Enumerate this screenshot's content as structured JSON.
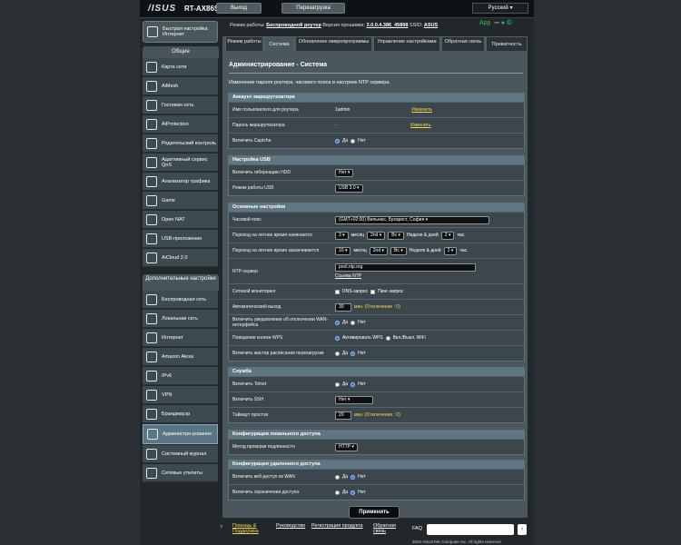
{
  "header": {
    "brand": "/ISUS",
    "model": "RT-AX86S",
    "logout": "Выход",
    "reboot": "Перезагрузка",
    "language": "Русский"
  },
  "info": {
    "mode_label": "Режим работы:",
    "mode_value": "Беспроводной роутер",
    "fw_label": "Версия прошивки:",
    "fw_value": "3.0.0.4.386_45898",
    "ssid_label": "SSID:",
    "ssid_value": "ASUS",
    "app": "App"
  },
  "sidebar": {
    "quick": "Быстрая настройка Интернет",
    "general_header": "Общие",
    "general": [
      "Карта сети",
      "AiMesh",
      "Гостевая сеть",
      "AiProtection",
      "Родительский контроль",
      "Адаптивный сервис QoS",
      "Анализатор трафика",
      "Game",
      "Open NAT",
      "USB-приложение",
      "AiCloud 2.0"
    ],
    "advanced_header": "Дополнительные настройки",
    "advanced": [
      "Беспроводная сеть",
      "Локальная сеть",
      "Интернет",
      "Amazon Alexa",
      "IPv6",
      "VPN",
      "Брандмауэр",
      "Администри-рование",
      "Системный журнал",
      "Сетевые утилиты"
    ]
  },
  "tabs": [
    "Режим работы",
    "Система",
    "Обновление микропрограммы",
    "Управление настройками",
    "Обратная связь",
    "Приватность"
  ],
  "page": {
    "title": "Администрирование - Система",
    "desc": "Изменение пароля роутера, часового пояса и настроек NTP сервера."
  },
  "sections": {
    "account": {
      "title": "Аккаунт маршрутизатора",
      "user_label": "Имя пользователя для роутера",
      "user_value": "1admin",
      "change": "Изменить",
      "pass_label": "Пароль маршрутизатора",
      "pass_value": "-",
      "captcha_label": "Включить Captcha",
      "yes": "Да",
      "no": "Нет"
    },
    "usb": {
      "title": "Настройка USB",
      "hdd_label": "Включить гибернацию HDD",
      "hdd_value": "Нет",
      "mode_label": "Режим работы USB",
      "mode_value": "USB 3.0"
    },
    "basic": {
      "title": "Основные настройки",
      "tz_label": "Часовой пояс",
      "tz_value": "(GMT+02:00) Вильнюс, Бухарест, София",
      "dst_start_label": "Переход на летнее время начинается",
      "dst_end_label": "Переход на летнее время заканчивается",
      "dst_start": {
        "m": "3",
        "w": "2nd",
        "d": "Вс",
        "h": "2"
      },
      "dst_end": {
        "m": "10",
        "w": "2nd",
        "d": "Вс",
        "h": "2"
      },
      "month": "месяц",
      "week_day": "Неделя & дней",
      "hour": "час.",
      "ntp_label": "NTP-сервер",
      "ntp_value": "pool.ntp.org",
      "ntp_link": "Ссылка NTP",
      "monitor_label": "Сетевой мониторинг",
      "dns": "DNS-запрос",
      "ping": "Пинг-запрос",
      "autologout_label": "Автоматический выход",
      "autologout_value": "30",
      "autologout_hint": "мин. (Отключение : 0)",
      "wan_notify_label": "Включить уведомление об отключении WAN-интерфейса",
      "wps_label": "Поведение кнопки WPS",
      "wps_opt1": "Активировать WPS",
      "wps_opt2": "Вкл./Выкл. WiFi",
      "reboot_sched_label": "Включить мастер расписания перезагрузки"
    },
    "service": {
      "title": "Служба",
      "telnet_label": "Включить Telnet",
      "ssh_label": "Включить SSH",
      "ssh_value": "Нет",
      "idle_label": "Таймаут простоя",
      "idle_value": "20",
      "idle_hint": "мин. (Отключение : 0)"
    },
    "local": {
      "title": "Конфигурация локального доступа",
      "auth_label": "Метод проверки подлинности",
      "auth_value": "HTTP"
    },
    "remote": {
      "title": "Конфигурация удаленного доступа",
      "wan_label": "Включить веб-доступ из WAN",
      "restrict_label": "Включить ограничения доступа"
    }
  },
  "apply": "Применить",
  "footer": {
    "help": "Помощь & Поддержка",
    "manual": "Руководство",
    "reg": "Регистрация продукта",
    "feedback": "Обратная связь",
    "faq": "FAQ",
    "copyright": "2020 ASUSTeK Computer Inc. All rights reserved."
  }
}
